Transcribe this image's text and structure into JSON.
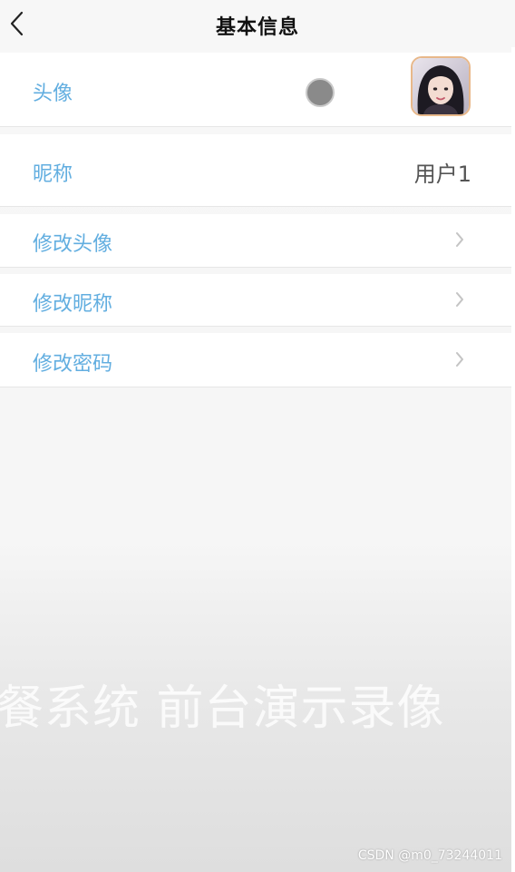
{
  "header": {
    "title": "基本信息",
    "back_icon": "chevron-left-icon"
  },
  "rows": {
    "avatar": {
      "label": "头像",
      "image": "user-avatar-photo"
    },
    "nickname": {
      "label": "昵称",
      "value": "用户1"
    },
    "change_avatar": {
      "label": "修改头像",
      "icon": "chevron-right-icon"
    },
    "change_nickname": {
      "label": "修改昵称",
      "icon": "chevron-right-icon"
    },
    "change_password": {
      "label": "修改密码",
      "icon": "chevron-right-icon"
    }
  },
  "overlay": {
    "video_caption": "餐系统 前台演示录像",
    "csdn_watermark": "CSDN @m0_73244011"
  },
  "colors": {
    "label": "#62aee0",
    "page_bg": "#f7f7f7",
    "row_bg": "#ffffff",
    "avatar_border": "#e8b88a"
  }
}
